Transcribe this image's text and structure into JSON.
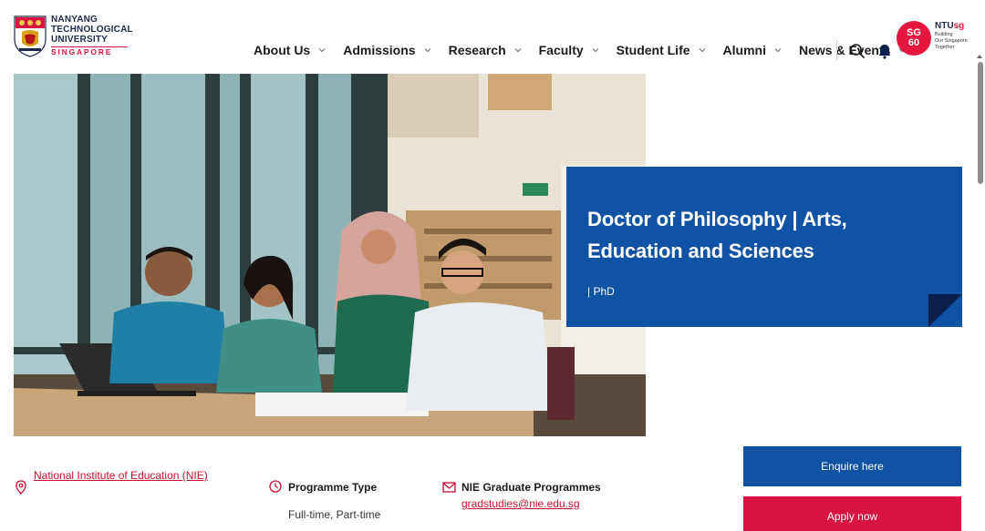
{
  "logo": {
    "line1": "NANYANG",
    "line2": "TECHNOLOGICAL",
    "line3": "UNIVERSITY",
    "line4": "SINGAPORE"
  },
  "nav": {
    "items": [
      {
        "label": "About Us"
      },
      {
        "label": "Admissions"
      },
      {
        "label": "Research"
      },
      {
        "label": "Faculty"
      },
      {
        "label": "Student Life"
      },
      {
        "label": "Alumni"
      },
      {
        "label": "News & Events"
      }
    ]
  },
  "sg60": {
    "badge_line1": "SG",
    "badge_line2": "60",
    "brand_prefix": "NTU",
    "brand_suffix": "sg",
    "tagline1": "Building",
    "tagline2": "Our Singapore",
    "tagline3": "Together"
  },
  "hero": {
    "title": "Doctor of Philosophy | Arts, Education and Sciences",
    "subtitle": "| PhD",
    "card_color": "#1053a5"
  },
  "info": {
    "location_link": "National Institute of Education (NIE)",
    "programme_type_label": "Programme Type",
    "programme_type_value": "Full-time, Part-time",
    "contact_label": "NIE Graduate Programmes",
    "contact_email": "gradstudies@nie.edu.sg"
  },
  "actions": {
    "enquire_label": "Enquire here",
    "apply_label": "Apply now",
    "enquire_color": "#1053a5",
    "apply_color": "#d71440"
  },
  "icons": {
    "search": "search-icon",
    "bell": "bell-icon",
    "pin": "map-pin-icon",
    "clock": "clock-icon",
    "mail": "mail-icon"
  }
}
